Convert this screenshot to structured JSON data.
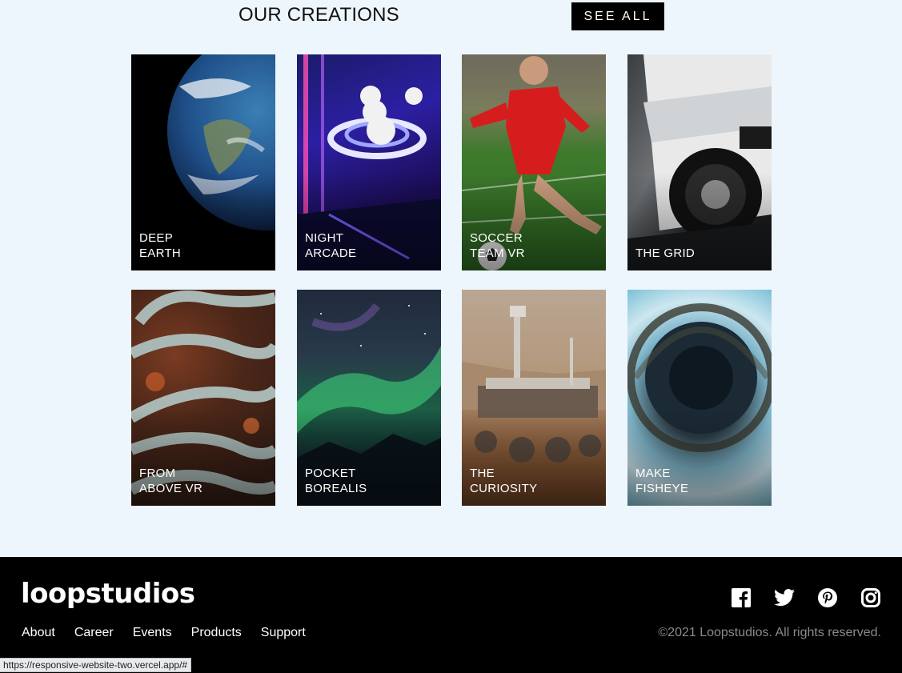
{
  "creations": {
    "title": "OUR CREATIONS",
    "see_all_label": "SEE ALL",
    "cards": [
      {
        "label": "DEEP\nEARTH"
      },
      {
        "label": "NIGHT\nARCADE"
      },
      {
        "label": "SOCCER\nTEAM VR"
      },
      {
        "label": "THE GRID"
      },
      {
        "label": "FROM\nABOVE VR"
      },
      {
        "label": "POCKET\nBOREALIS"
      },
      {
        "label": "THE\nCURIOSITY"
      },
      {
        "label": "MAKE\nFISHEYE"
      }
    ]
  },
  "footer": {
    "logo": "loopstudios",
    "nav": [
      "About",
      "Career",
      "Events",
      "Products",
      "Support"
    ],
    "socials": [
      "facebook-icon",
      "twitter-icon",
      "pinterest-icon",
      "instagram-icon"
    ],
    "copyright": "©2021 Loopstudios. All rights reserved."
  },
  "status_bar": {
    "url": "https://responsive-website-two.vercel.app/#"
  },
  "colors": {
    "page_background": "#eef6fd",
    "footer_background": "#000000",
    "accent_button": "#000000"
  }
}
